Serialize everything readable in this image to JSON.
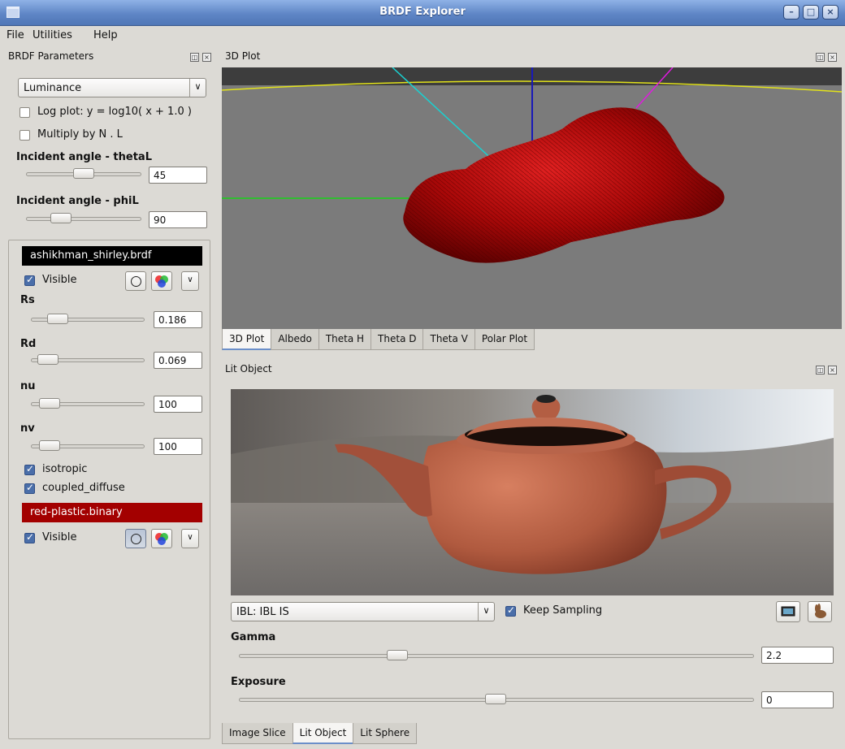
{
  "window": {
    "title": "BRDF Explorer"
  },
  "menu": {
    "file": "File",
    "utilities": "Utilities",
    "help": "Help"
  },
  "brdf_params": {
    "title": "BRDF Parameters",
    "channel": "Luminance",
    "log_plot_label": "Log plot:  y = log10( x + 1.0 )",
    "log_plot_checked": false,
    "multiply_label": "Multiply by N . L",
    "multiply_checked": false,
    "thetaL_label": "Incident angle - thetaL",
    "thetaL_value": "45",
    "thetaL_fraction": 0.5,
    "phiL_label": "Incident angle - phiL",
    "phiL_value": "90",
    "phiL_fraction": 0.25,
    "brdf1": {
      "name": "ashikhman_shirley.brdf",
      "visible_label": "Visible",
      "visible": true,
      "params": [
        {
          "label": "Rs",
          "value": "0.186"
        },
        {
          "label": "Rd",
          "value": "0.069"
        },
        {
          "label": "nu",
          "value": "100"
        },
        {
          "label": "nv",
          "value": "100"
        }
      ],
      "isotropic_label": "isotropic",
      "coupled_label": "coupled_diffuse"
    },
    "brdf2": {
      "name": "red-plastic.binary",
      "visible_label": "Visible",
      "visible": true
    }
  },
  "plot3d": {
    "title": "3D Plot",
    "tabs": [
      "3D Plot",
      "Albedo",
      "Theta H",
      "Theta D",
      "Theta V",
      "Polar Plot"
    ],
    "active_tab": "3D Plot"
  },
  "lit_object": {
    "title": "Lit Object",
    "ibl_mode": "IBL: IBL IS",
    "keep_sampling_label": "Keep Sampling",
    "keep_sampling": true,
    "gamma_label": "Gamma",
    "gamma_value": "2.2",
    "gamma_fraction": 0.3,
    "exposure_label": "Exposure",
    "exposure_value": "0",
    "exposure_fraction": 0.5,
    "tabs": [
      "Image Slice",
      "Lit Object",
      "Lit Sphere"
    ],
    "active_tab": "Lit Object"
  },
  "colors": {
    "selection": "#000000",
    "selection2": "#a30000",
    "accent": "#4a6ea9",
    "title_bar": "#5f86c6"
  },
  "icons": [
    "window-icon",
    "minimize-icon",
    "maximize-icon",
    "close-icon",
    "float-icon",
    "circle-icon",
    "color-wheel-icon",
    "chevron-down-icon",
    "image-icon",
    "bunny-icon"
  ]
}
